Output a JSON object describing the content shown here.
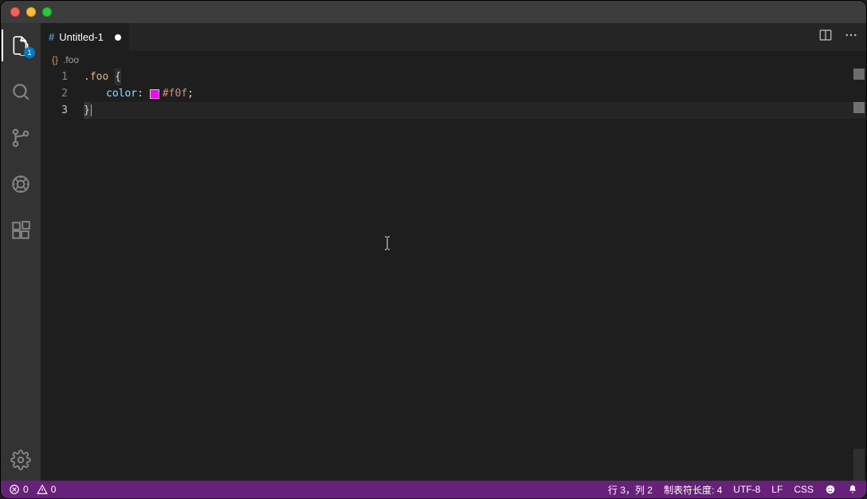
{
  "activity": {
    "explorer_badge": "1"
  },
  "tab": {
    "icon_text": "#",
    "title": "Untitled-1"
  },
  "breadcrumb": {
    "icon": "{}",
    "item": ".foo"
  },
  "editor": {
    "lines": {
      "l1": {
        "num": "1",
        "selector": ".foo",
        "open": "{"
      },
      "l2": {
        "num": "2",
        "prop": "color",
        "colon": ":",
        "swatch_color": "#f0f",
        "value": "#f0f",
        "semi": ";"
      },
      "l3": {
        "num": "3",
        "close": "}"
      }
    }
  },
  "status": {
    "errors": "0",
    "warnings": "0",
    "cursor": "行 3，列 2",
    "tabsize": "制表符长度: 4",
    "encoding": "UTF-8",
    "eol": "LF",
    "lang": "CSS"
  }
}
